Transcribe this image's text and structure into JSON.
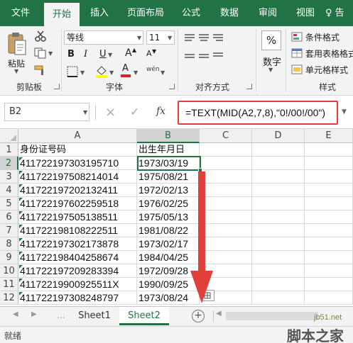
{
  "ribbon_tabs": {
    "file": "文件",
    "home": "开始",
    "insert": "插入",
    "page_layout": "页面布局",
    "formulas": "公式",
    "data": "数据",
    "review": "审阅",
    "view": "视图",
    "tell_me": "♀ 告"
  },
  "clipboard": {
    "paste": "粘贴",
    "label": "剪贴板"
  },
  "font": {
    "name": "等线",
    "size": "11",
    "bold": "B",
    "italic": "I",
    "underline": "U",
    "grow": "A",
    "shrink": "A",
    "font_color_glyph": "A",
    "phonetic": "wén",
    "label": "字体"
  },
  "alignment": {
    "label": "对齐方式"
  },
  "number": {
    "percent": "%",
    "label": "数字"
  },
  "styles": {
    "conditional": "条件格式",
    "table_format": "套用表格格式",
    "cell_styles": "单元格样式",
    "label": "样式"
  },
  "formula_bar": {
    "name_box": "B2",
    "cancel": "×",
    "enter": "✓",
    "fx": "fx",
    "formula": "=TEXT(MID(A2,7,8),\"0!/00!/00\")"
  },
  "columns": [
    "A",
    "B",
    "C",
    "D",
    "E"
  ],
  "rows": [
    {
      "n": "1",
      "a": "身份证号码",
      "b": "出生年月日"
    },
    {
      "n": "2",
      "a": "411722197303195710",
      "b": "1973/03/19"
    },
    {
      "n": "3",
      "a": "411722197508214014",
      "b": "1975/08/21"
    },
    {
      "n": "4",
      "a": "411722197202132411",
      "b": "1972/02/13"
    },
    {
      "n": "5",
      "a": "411722197602259518",
      "b": "1976/02/25"
    },
    {
      "n": "6",
      "a": "411722197505138511",
      "b": "1975/05/13"
    },
    {
      "n": "7",
      "a": "411722198108222511",
      "b": "1981/08/22"
    },
    {
      "n": "8",
      "a": "411722197302173878",
      "b": "1973/02/17"
    },
    {
      "n": "9",
      "a": "411722198404258674",
      "b": "1984/04/25"
    },
    {
      "n": "10",
      "a": "411722197209283394",
      "b": "1972/09/28"
    },
    {
      "n": "11",
      "a": "41172219900925511X",
      "b": "1990/09/25"
    },
    {
      "n": "12",
      "a": "411722197308248797",
      "b": "1973/08/24"
    }
  ],
  "sheets": {
    "tab1": "Sheet1",
    "tab2": "Sheet2",
    "add": "+"
  },
  "status": {
    "ready": "就绪"
  },
  "watermark": {
    "site": "jb51.net",
    "name": "脚本之家"
  },
  "colors": {
    "excel_green": "#217346",
    "highlight_red": "#e0403a"
  }
}
